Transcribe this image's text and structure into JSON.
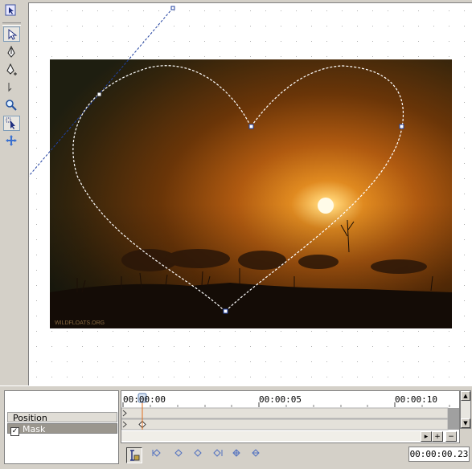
{
  "tools": [
    {
      "name": "pointer-icon",
      "active": false
    },
    {
      "name": "select-arrow-icon",
      "active": true
    },
    {
      "name": "pen-icon",
      "active": false
    },
    {
      "name": "add-point-pen-icon",
      "active": false
    },
    {
      "name": "convert-point-icon",
      "active": false
    },
    {
      "name": "zoom-icon",
      "active": false
    },
    {
      "name": "anchor-select-icon",
      "active": true
    },
    {
      "name": "move-arrows-icon",
      "active": false
    }
  ],
  "canvas": {
    "image_watermark": "WILDFLOATS.ORG",
    "mask_shape": "heart"
  },
  "tracks": {
    "position_label": "Position",
    "mask_label": "Mask",
    "mask_checked": true
  },
  "timeline": {
    "ticks": [
      "00:00:00",
      "00:00:05",
      "00:00:10"
    ],
    "zoom_in_label": "+",
    "zoom_out_label": "−"
  },
  "transport": {
    "timecode": "00:00:00.23"
  },
  "colors": {
    "chrome": "#d4d0c8",
    "selection": "#7f9db9",
    "playhead": "#e07020"
  }
}
